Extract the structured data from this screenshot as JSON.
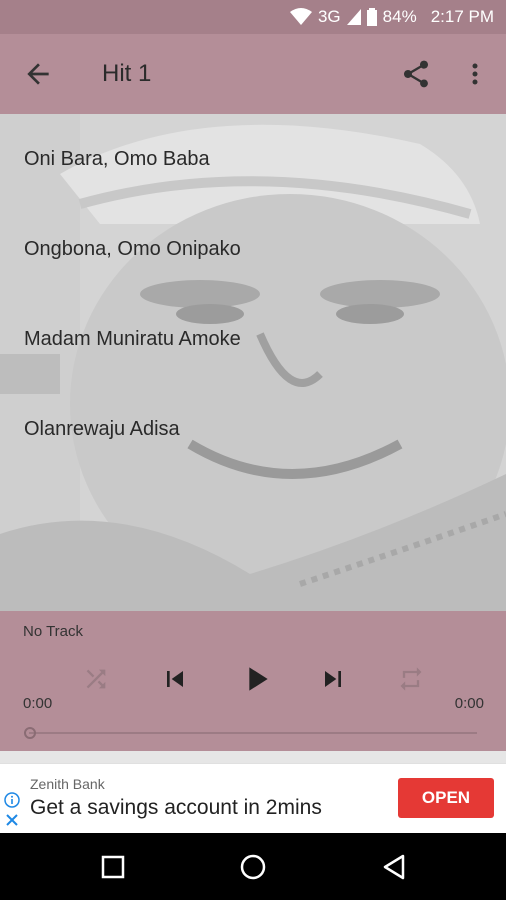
{
  "status_bar": {
    "network": "3G",
    "battery": "84%",
    "time": "2:17 PM",
    "icons": [
      "wifi-icon",
      "signal-icon",
      "battery-icon"
    ]
  },
  "app_bar": {
    "title": "Hit 1",
    "icons": [
      "back-arrow-icon",
      "share-icon",
      "more-vert-icon"
    ]
  },
  "tracks": [
    {
      "title": "Oni Bara, Omo Baba"
    },
    {
      "title": "Ongbona, Omo Onipako"
    },
    {
      "title": "Madam Muniratu Amoke"
    },
    {
      "title": "Olanrewaju Adisa"
    }
  ],
  "player": {
    "now_playing": "No Track",
    "elapsed": "0:00",
    "duration": "0:00",
    "progress": 0,
    "controls": [
      "shuffle-icon",
      "skip-previous-icon",
      "play-icon",
      "skip-next-icon",
      "repeat-icon"
    ]
  },
  "ad": {
    "advertiser": "Zenith Bank",
    "headline": "Get a savings account in 2mins",
    "cta": "OPEN",
    "cta_color": "#e53935"
  },
  "colors": {
    "accent": "#b48e98",
    "status_bar": "#a5808a"
  },
  "nav_bar": {
    "icons": [
      "recents-icon",
      "home-icon",
      "back-triangle-icon"
    ]
  }
}
